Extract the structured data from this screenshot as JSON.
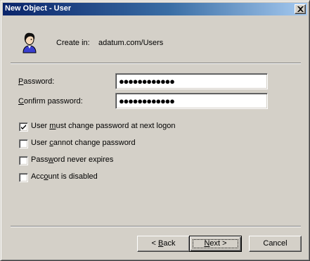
{
  "window": {
    "title": "New Object - User",
    "close_icon": "close-icon"
  },
  "header": {
    "icon": "user-icon",
    "create_in_label": "Create in:",
    "create_in_value": "adatum.com/Users"
  },
  "fields": {
    "password": {
      "label_prefix": "",
      "label_mnemonic": "P",
      "label_rest": "assword:",
      "masked_value": "●●●●●●●●●●●●"
    },
    "confirm_password": {
      "label_prefix": "",
      "label_mnemonic": "C",
      "label_rest": "onfirm password:",
      "masked_value": "●●●●●●●●●●●●"
    }
  },
  "options": [
    {
      "label_prefix": "User ",
      "label_mnemonic": "m",
      "label_rest": "ust change password at next logon",
      "checked": true
    },
    {
      "label_prefix": "User ",
      "label_mnemonic": "c",
      "label_rest": "annot change password",
      "checked": false
    },
    {
      "label_prefix": "Pass",
      "label_mnemonic": "w",
      "label_rest": "ord never expires",
      "checked": false
    },
    {
      "label_prefix": "Acc",
      "label_mnemonic": "o",
      "label_rest": "unt is disabled",
      "checked": false
    }
  ],
  "buttons": {
    "back": {
      "prefix": "< ",
      "mnemonic": "B",
      "rest": "ack"
    },
    "next": {
      "prefix": "",
      "mnemonic": "N",
      "rest": "ext >"
    },
    "cancel": {
      "label": "Cancel"
    }
  },
  "colors": {
    "face": "#d4d0c8",
    "title_start": "#0a246a",
    "title_end": "#a6caf0"
  }
}
